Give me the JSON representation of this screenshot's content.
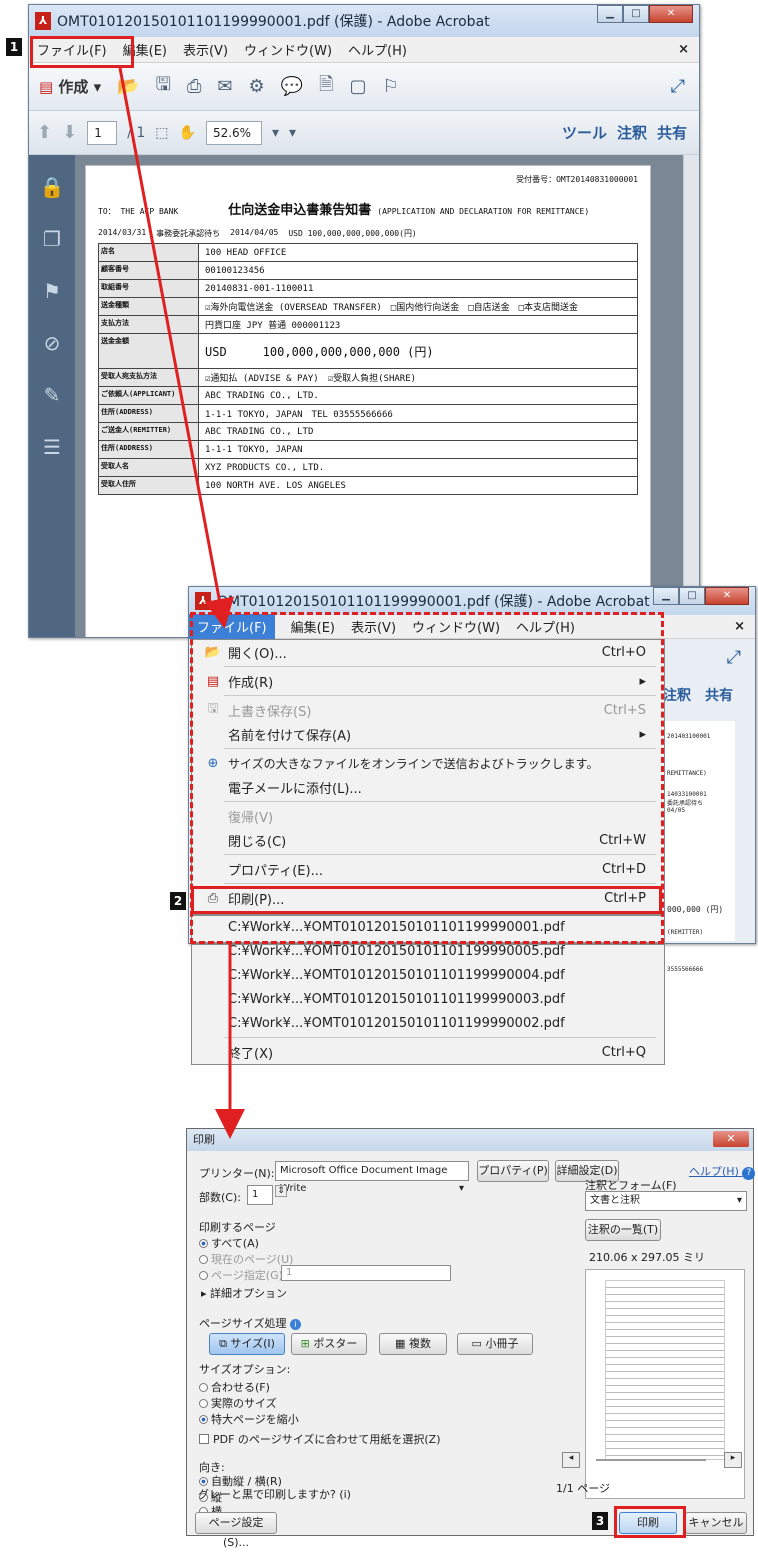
{
  "win1": {
    "title": "OMT0101201501011011999900​01.pdf (保護) - Adobe Acrobat",
    "menu": [
      "ファイル(F)",
      "編集(E)",
      "表示(V)",
      "ウィンドウ(W)",
      "ヘルプ(H)"
    ],
    "create_label": "作成",
    "page_value": "1",
    "page_total": "/ 1",
    "zoom": "52.6%",
    "tools": "ツール",
    "comment": "注釈",
    "share": "共有"
  },
  "doc": {
    "receipt": "受付番号：OMT20140831000001",
    "to": "TO： THE ACP BANK",
    "title": "仕向送金申込書兼告知書",
    "title_en": "(APPLICATION AND DECLARATION FOR REMITTANCE)",
    "rows": [
      {
        "l": "店名",
        "v": "100 HEAD OFFICE"
      },
      {
        "l": "顧客番号",
        "v": "00100123456"
      },
      {
        "l": "取組番号",
        "v": "20140831-001-1100011"
      },
      {
        "l": "送金種類",
        "v": "☑海外向電信送金 (OVERSEAD TRANSFER)　□国内他行向送金　□自店送金　□本支店間送金"
      },
      {
        "l": "支払方法",
        "v": "円貨口座 JPY 普通 000001123"
      },
      {
        "l": "送金金額",
        "v": "USD　　　100,000,000,000,000 (円)"
      },
      {
        "l": "受取人宛支払方法",
        "v": "☑通知払 (ADVISE & PAY)　☑受取人負担(SHARE)"
      },
      {
        "l": "ご依頼人(APPLICANT)",
        "v": "ABC TRADING CO., LTD."
      },
      {
        "l": "住所(ADDRESS)",
        "v": "1-1-1 TOKYO, JAPAN　TEL 03555566666"
      },
      {
        "l": "ご送金人(REMITTER)",
        "v": "ABC TRADING CO., LTD"
      },
      {
        "l": "住所(ADDRESS)",
        "v": "1-1-1 TOKYO, JAPAN"
      },
      {
        "l": "受取人名",
        "v": "XYZ PRODUCTS CO., LTD."
      },
      {
        "l": "受取人住所",
        "v": "100 NORTH AVE. LOS ANGELES"
      }
    ],
    "date1": "2014/03/31",
    "date2": "2014/04/05",
    "status": "事務委託承認待ち",
    "amount": "USD 100,000,000,000,000(円)"
  },
  "win2": {
    "title": "OMT0101201501011011999900​01.pdf (保護) - Adobe Acrobat",
    "menu": [
      "ファイル(F)",
      "編集(E)",
      "表示(V)",
      "ウィンドウ(W)",
      "ヘルプ(H)"
    ],
    "items": [
      {
        "label": "開く(O)...",
        "sc": "Ctrl+O"
      },
      {
        "label": "作成(R)",
        "sc": ""
      },
      {
        "label": "上書き保存(S)",
        "sc": "Ctrl+S"
      },
      {
        "label": "名前を付けて保存(A)",
        "sc": ""
      },
      {
        "label": "サイズの大きなファイルをオンラインで送信およびトラックします。",
        "sc": ""
      },
      {
        "label": "電子メールに添付(L)...",
        "sc": ""
      },
      {
        "label": "復帰(V)",
        "sc": ""
      },
      {
        "label": "閉じる(C)",
        "sc": "Ctrl+W"
      },
      {
        "label": "プロパティ(E)...",
        "sc": "Ctrl+D"
      },
      {
        "label": "印刷(P)...",
        "sc": "Ctrl+P"
      },
      {
        "label": "C:¥Work¥...¥OMT0101201501011011999900​01.pdf",
        "sc": ""
      },
      {
        "label": "C:¥Work¥...¥OMT0101201501011011999900​05.pdf",
        "sc": ""
      },
      {
        "label": "C:¥Work¥...¥OMT0101201501011011999900​04.pdf",
        "sc": ""
      },
      {
        "label": "C:¥Work¥...¥OMT0101201501011011999900​03.pdf",
        "sc": ""
      },
      {
        "label": "C:¥Work¥...¥OMT0101201501011011999900​02.pdf",
        "sc": ""
      },
      {
        "label": "終了(X)",
        "sc": "Ctrl+Q"
      }
    ],
    "right_comment": "注釈",
    "right_share": "共有"
  },
  "dlg": {
    "title": "印刷",
    "printer_label": "プリンター(N):",
    "printer": "Microsoft Office Document Image Write",
    "properties": "プロパティ(P)",
    "advanced": "詳細設定(D)",
    "help": "ヘルプ(H)",
    "copies_label": "部数(C):",
    "copies": "1",
    "pages_head": "印刷するページ",
    "all": "すべて(A)",
    "current": "現在のページ(U)",
    "range": "ページ指定(G)",
    "range_val": "1",
    "more": "詳細オプション",
    "sizing_head": "ページサイズ処理",
    "size_btn": "サイズ(I)",
    "poster_btn": "ポスター",
    "multiple_btn": "複数",
    "booklet_btn": "小冊子",
    "size_opts": "サイズオプション:",
    "fit": "合わせる(F)",
    "actual": "実際のサイズ",
    "shrink": "特大ページを縮小",
    "pdfsize": "PDF のページサイズに合わせて用紙を選択(Z)",
    "orient": "向き:",
    "auto": "自動縦 / 横(R)",
    "portrait": "縦",
    "landscape": "横",
    "gray": "グレーと黒で印刷しますか? (i)",
    "cf_label": "注釈とフォーム(F)",
    "cf_value": "文書と注釈",
    "summary": "注釈の一覧(T)",
    "dims": "210.06 x 297.05 ミリ",
    "pageinfo": "1/1 ページ",
    "setup": "ページ設定(S)...",
    "print": "印刷",
    "cancel": "キャンセル"
  },
  "steps": [
    "1",
    "2",
    "3"
  ]
}
